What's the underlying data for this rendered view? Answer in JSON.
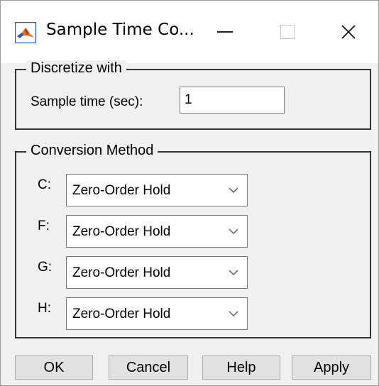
{
  "window": {
    "title": "Sample Time Co...",
    "minimize_glyph": "—",
    "close_glyph": "✕"
  },
  "discretize": {
    "legend": "Discretize with",
    "sample_time_label": "Sample time (sec):",
    "sample_time_value": "1"
  },
  "conversion": {
    "legend": "Conversion Method",
    "rows": [
      {
        "label": "C:",
        "value": "Zero-Order Hold"
      },
      {
        "label": "F:",
        "value": "Zero-Order Hold"
      },
      {
        "label": "G:",
        "value": "Zero-Order Hold"
      },
      {
        "label": "H:",
        "value": "Zero-Order Hold"
      }
    ]
  },
  "buttons": {
    "ok": "OK",
    "cancel": "Cancel",
    "help": "Help",
    "apply": "Apply"
  },
  "colors": {
    "dialog_background": "#f0f0f0",
    "titlebar_background": "#ffffff",
    "button_face": "#e1e1e1",
    "icon_accent": "#e8751a",
    "icon_blue": "#1f5fbf"
  },
  "icons": {
    "app": "matlab-logo-icon",
    "dropdown": "chevron-down-icon"
  }
}
